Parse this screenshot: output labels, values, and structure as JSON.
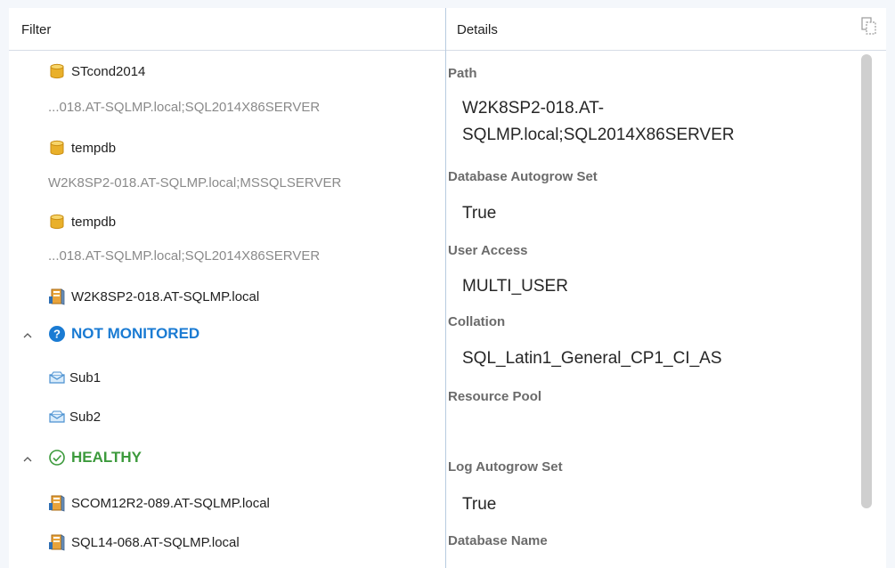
{
  "filter": {
    "header": "Filter",
    "items": [
      {
        "name": "STcond2014",
        "icon": "database-icon"
      },
      {
        "path": "...018.AT-SQLMP.local;SQL2014X86SERVER"
      },
      {
        "name": "tempdb",
        "icon": "database-icon"
      },
      {
        "path": "W2K8SP2-018.AT-SQLMP.local;MSSQLSERVER"
      },
      {
        "name": "tempdb",
        "icon": "database-icon"
      },
      {
        "path": "...018.AT-SQLMP.local;SQL2014X86SERVER"
      },
      {
        "name": "W2K8SP2-018.AT-SQLMP.local",
        "icon": "computer-icon"
      }
    ],
    "groups": {
      "not_monitored": {
        "label": "NOT MONITORED",
        "color": "#1a7bd3",
        "items": [
          "Sub1",
          "Sub2"
        ]
      },
      "healthy": {
        "label": "HEALTHY",
        "color": "#3c9a3c",
        "items": [
          "SCOM12R2-089.AT-SQLMP.local",
          "SQL14-068.AT-SQLMP.local"
        ]
      }
    }
  },
  "details": {
    "header": "Details",
    "fields": [
      {
        "label": "Path",
        "value": "W2K8SP2-018.AT-SQLMP.local;SQL2014X86SERVER"
      },
      {
        "label": "Database Autogrow Set",
        "value": "True"
      },
      {
        "label": "User Access",
        "value": "MULTI_USER"
      },
      {
        "label": "Collation",
        "value": "SQL_Latin1_General_CP1_CI_AS"
      },
      {
        "label": "Resource Pool",
        "value": ""
      },
      {
        "label": "Log Autogrow Set",
        "value": "True"
      },
      {
        "label": "Database Name",
        "value": ""
      }
    ]
  }
}
